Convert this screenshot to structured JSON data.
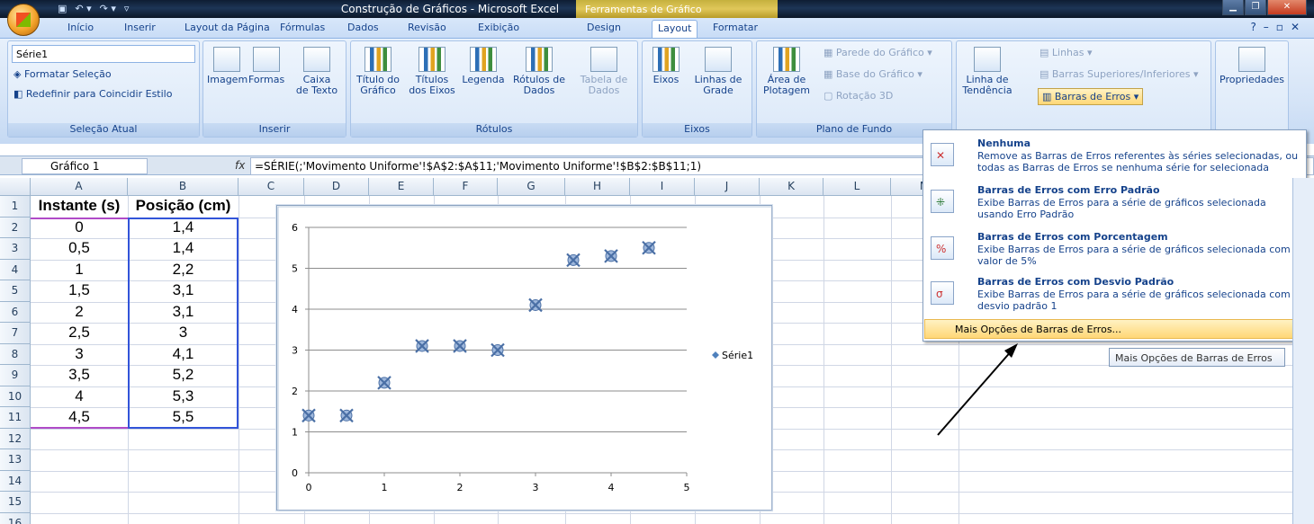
{
  "window": {
    "title": "Construção de Gráficos - Microsoft Excel",
    "context_tab_header": "Ferramentas de Gráfico"
  },
  "tabs": [
    "Início",
    "Inserir",
    "Layout da Página",
    "Fórmulas",
    "Dados",
    "Revisão",
    "Exibição",
    "Design",
    "Layout",
    "Formatar"
  ],
  "ribbon": {
    "selecao": {
      "combo": "Série1",
      "format_sel": "Formatar Seleção",
      "reset": "Redefinir para Coincidir Estilo",
      "label": "Seleção Atual"
    },
    "inserir": {
      "imagem": "Imagem",
      "formas": "Formas",
      "caixa1": "Caixa",
      "caixa2": "de Texto",
      "label": "Inserir"
    },
    "rotulos": {
      "titulo1": "Título do",
      "titulo2": "Gráfico",
      "titulos1": "Títulos",
      "titulos2": "dos Eixos",
      "legenda": "Legenda",
      "rot1": "Rótulos de",
      "rot2": "Dados",
      "tab1": "Tabela de",
      "tab2": "Dados",
      "label": "Rótulos"
    },
    "eixos": {
      "eixos": "Eixos",
      "linhas1": "Linhas de",
      "linhas2": "Grade",
      "label": "Eixos"
    },
    "fundo": {
      "area1": "Área de",
      "area2": "Plotagem",
      "parede": "Parede do Gráfico",
      "base": "Base do Gráfico",
      "rotacao": "Rotação 3D",
      "label": "Plano de Fundo"
    },
    "analise": {
      "tend1": "Linha de",
      "tend2": "Tendência",
      "linhas": "Linhas",
      "barras_sup": "Barras Superiores/Inferiores",
      "barras_erros": "Barras de Erros"
    },
    "props": {
      "label": "Propriedades"
    }
  },
  "formula_bar": {
    "name_box": "Gráfico 1",
    "fx": "fx",
    "formula": "=SÉRIE(;'Movimento Uniforme'!$A$2:$A$11;'Movimento Uniforme'!$B$2:$B$11;1)"
  },
  "sheet": {
    "columns": [
      "A",
      "B",
      "C",
      "D",
      "E",
      "F",
      "G",
      "H",
      "I",
      "J",
      "K",
      "L",
      "M"
    ],
    "rows": [
      "1",
      "2",
      "3",
      "4",
      "5",
      "6",
      "7",
      "8",
      "9",
      "10",
      "11",
      "12",
      "13",
      "14",
      "15",
      "16"
    ],
    "header_a": "Instante (s)",
    "header_b": "Posição (cm)",
    "col_a": [
      "0",
      "0,5",
      "1",
      "1,5",
      "2",
      "2,5",
      "3",
      "3,5",
      "4",
      "4,5"
    ],
    "col_b": [
      "1,4",
      "1,4",
      "2,2",
      "3,1",
      "3,1",
      "3",
      "4,1",
      "5,2",
      "5,3",
      "5,5"
    ]
  },
  "chart_data": {
    "type": "scatter",
    "series": [
      {
        "name": "Série1",
        "x": [
          0,
          0.5,
          1,
          1.5,
          2,
          2.5,
          3,
          3.5,
          4,
          4.5
        ],
        "y": [
          1.4,
          1.4,
          2.2,
          3.1,
          3.1,
          3,
          4.1,
          5.2,
          5.3,
          5.5
        ]
      }
    ],
    "xlim": [
      0,
      5
    ],
    "ylim": [
      0,
      6
    ],
    "x_ticks": [
      "0",
      "1",
      "2",
      "3",
      "4",
      "5"
    ],
    "y_ticks": [
      "0",
      "1",
      "2",
      "3",
      "4",
      "5",
      "6"
    ],
    "legend": "right",
    "grid": "horizontal"
  },
  "menu": {
    "items": [
      {
        "title": "Nenhuma",
        "desc": "Remove as Barras de Erros referentes às séries selecionadas, ou todas as Barras de Erros se nenhuma série for selecionada"
      },
      {
        "title": "Barras de Erros com Erro Padrão",
        "desc": "Exibe Barras de Erros para a série de gráficos selecionada usando Erro Padrão"
      },
      {
        "title": "Barras de Erros com Porcentagem",
        "desc": "Exibe Barras de Erros para a série de gráficos selecionada com valor de 5%"
      },
      {
        "title": "Barras de Erros com Desvio Padrão",
        "desc": "Exibe Barras de Erros para a série de gráficos selecionada com desvio padrão 1"
      }
    ],
    "more": "Mais Opções de Barras de Erros..."
  },
  "tooltip": "Mais Opções de Barras de Erros"
}
